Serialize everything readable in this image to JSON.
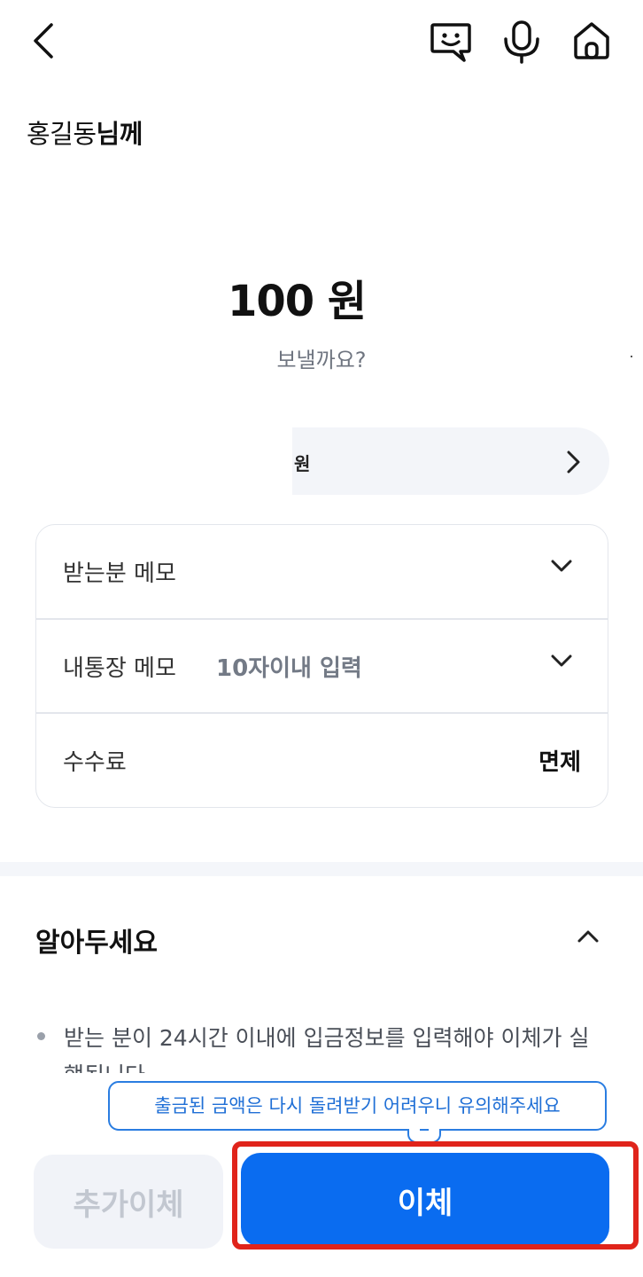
{
  "header": {
    "back_icon": "chevron-left-icon",
    "chat_icon": "chatbot-icon",
    "mic_icon": "microphone-icon",
    "home_icon": "home-icon"
  },
  "recipient": {
    "name": "홍길동",
    "suffix": "님께"
  },
  "amount": {
    "text": "100 원",
    "question": "보낼까요?"
  },
  "balance": {
    "text": "원"
  },
  "memo": {
    "receiver_label": "받는분 메모",
    "mine_label": "내통장 메모",
    "mine_placeholder": "10자이내 입력",
    "fee_label": "수수료",
    "fee_value": "면제"
  },
  "notice": {
    "title": "알아두세요",
    "item": "받는 분이 24시간 이내에 입금정보를 입력해야 이체가 실행됩니다"
  },
  "tooltip": {
    "text": "출금된 금액은 다시 돌려받기 어려우니 유의해주세요"
  },
  "buttons": {
    "more": "추가이체",
    "transfer": "이체"
  },
  "colors": {
    "primary": "#0a6cf0",
    "highlight": "#e0241b",
    "tooltip": "#2a7de1"
  }
}
